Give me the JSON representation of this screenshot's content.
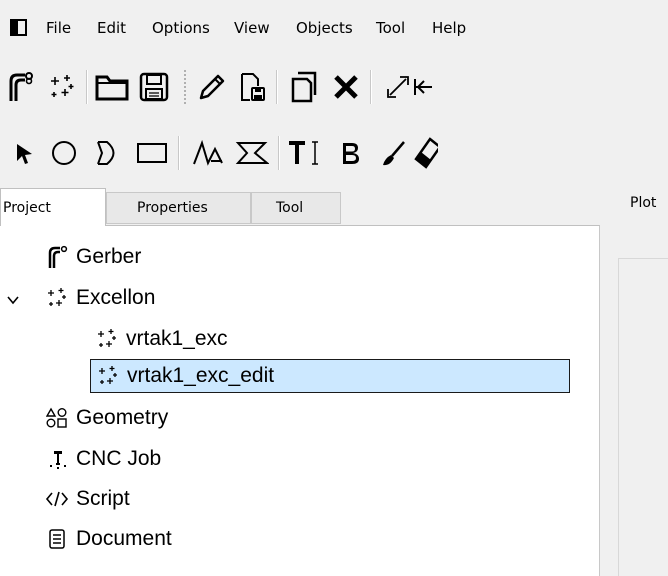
{
  "menu": {
    "items": [
      "File",
      "Edit",
      "Options",
      "View",
      "Objects",
      "Tool",
      "Help"
    ]
  },
  "toolbar1": {
    "icons": [
      "gerber-icon",
      "excellon-icon",
      "open-folder-icon",
      "save-icon",
      "edit-pencil-icon",
      "save-as-icon",
      "copy-icon",
      "delete-icon",
      "resize-icon",
      "move-icon"
    ]
  },
  "toolbar2": {
    "icons": [
      "select-arrow-icon",
      "circle-icon",
      "arc-icon",
      "rectangle-icon",
      "path-icon",
      "polygon-icon",
      "text-icon",
      "buffer-icon",
      "paint-icon",
      "eraser-icon"
    ]
  },
  "tabs": {
    "project": "Project",
    "properties": "Properties",
    "tool": "Tool",
    "plot": "Plot"
  },
  "tree": {
    "items": [
      {
        "label": "Gerber",
        "icon": "gerber-icon"
      },
      {
        "label": "Excellon",
        "icon": "excellon-icon"
      },
      {
        "label": "vrtak1_exc",
        "icon": "excellon-icon"
      },
      {
        "label": "vrtak1_exc_edit",
        "icon": "excellon-icon"
      },
      {
        "label": "Geometry",
        "icon": "geometry-icon"
      },
      {
        "label": "CNC Job",
        "icon": "cnc-job-icon"
      },
      {
        "label": "Script",
        "icon": "script-icon"
      },
      {
        "label": "Document",
        "icon": "document-icon"
      }
    ]
  }
}
